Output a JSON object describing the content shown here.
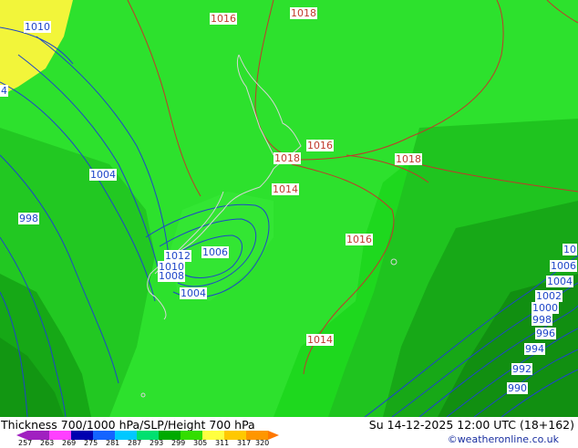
{
  "title": "Thickness 700/1000 hPa/SLP/Height 700 hPa",
  "valid_time": "Su 14-12-2025 12:00 UTC (18+162)",
  "credit": "©weatheronline.co.uk",
  "colorbar": {
    "ticks": [
      "257",
      "263",
      "269",
      "275",
      "281",
      "287",
      "293",
      "299",
      "305",
      "311",
      "317",
      "320"
    ],
    "colors": [
      "#a020c0",
      "#ff40ff",
      "#0000b0",
      "#1464ff",
      "#00c8ff",
      "#00e070",
      "#00aa00",
      "#33dd00",
      "#ffff40",
      "#ffc800",
      "#ff9600",
      "#ff7800"
    ]
  },
  "slp_labels_red": [
    "1016",
    "1018",
    "1016",
    "1018",
    "1018",
    "1014",
    "1016",
    "1014"
  ],
  "height_labels_blue": [
    "1010",
    "4",
    "1004",
    "998",
    "1012",
    "1010",
    "1008",
    "1006",
    "1004",
    "10",
    "1006",
    "1004",
    "1002",
    "1000",
    "998",
    "996",
    "994",
    "992",
    "990"
  ],
  "colors": {
    "slp_contour": "#c0392b",
    "height_contour": "#1e46c8",
    "coast": "#d6d6d6"
  }
}
